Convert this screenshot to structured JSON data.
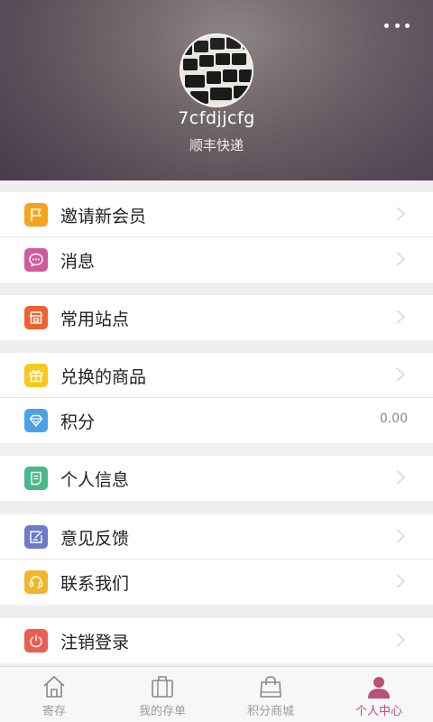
{
  "header": {
    "username": "7cfdjjcfg",
    "subtitle": "顺丰快递",
    "more_icon": "more-dots-icon"
  },
  "menu": [
    {
      "label": "邀请新会员",
      "icon": "flag-icon",
      "color": "#f7a21b"
    },
    {
      "label": "消息",
      "icon": "message-icon",
      "color": "#cf5b9a"
    },
    {
      "label": "常用站点",
      "icon": "store-icon",
      "color": "#f0622d"
    },
    {
      "label": "兑换的商品",
      "icon": "gift-icon",
      "color": "#f6c91c"
    },
    {
      "label": "积分",
      "icon": "diamond-icon",
      "color": "#4aa3e6",
      "value": "0.00"
    },
    {
      "label": "个人信息",
      "icon": "profile-card-icon",
      "color": "#48b98a"
    },
    {
      "label": "意见反馈",
      "icon": "feedback-icon",
      "color": "#6d7ac7"
    },
    {
      "label": "联系我们",
      "icon": "headset-icon",
      "color": "#f3b62a"
    },
    {
      "label": "注销登录",
      "icon": "power-icon",
      "color": "#ec5d52"
    }
  ],
  "tabs": [
    {
      "label": "寄存",
      "icon": "home-icon"
    },
    {
      "label": "我的存单",
      "icon": "bag-icon"
    },
    {
      "label": "积分商城",
      "icon": "shopping-bag-icon"
    },
    {
      "label": "个人中心",
      "icon": "person-icon",
      "active": true
    }
  ],
  "colors": {
    "accent": "#b8507a",
    "background": "#efefef"
  }
}
